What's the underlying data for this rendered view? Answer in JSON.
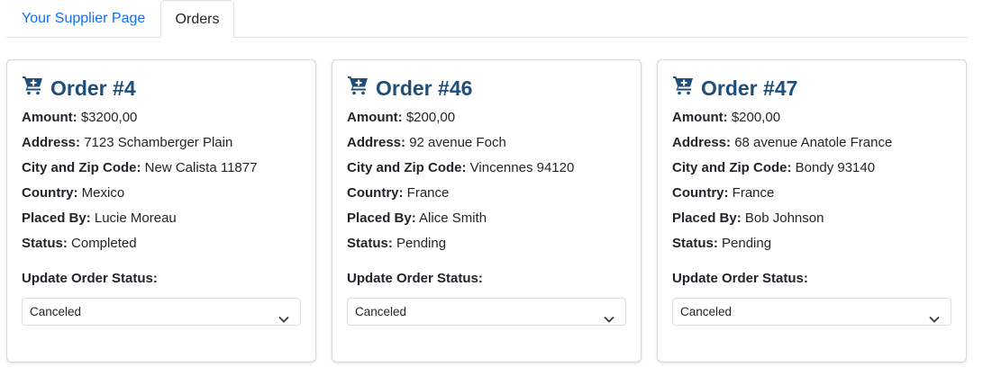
{
  "tabs": [
    {
      "label": "Your Supplier Page"
    },
    {
      "label": "Orders"
    }
  ],
  "labels": {
    "amount": "Amount:",
    "address": "Address:",
    "city_zip": "City and Zip Code:",
    "country": "Country:",
    "placed_by": "Placed By:",
    "status": "Status:",
    "update_status": "Update Order Status:"
  },
  "icons": {
    "order": "cart-plus-icon",
    "dropdown": "chevron-down-icon"
  },
  "colors": {
    "link": "#0d6efd",
    "title": "#1f4e79"
  },
  "orders": [
    {
      "title": "Order #4",
      "amount": "$3200,00",
      "address": "7123 Schamberger Plain",
      "city_zip": "New Calista 11877",
      "country": "Mexico",
      "placed_by": "Lucie Moreau",
      "status": "Completed",
      "select_value": "Canceled"
    },
    {
      "title": "Order #46",
      "amount": "$200,00",
      "address": "92 avenue Foch",
      "city_zip": "Vincennes 94120",
      "country": "France",
      "placed_by": "Alice Smith",
      "status": "Pending",
      "select_value": "Canceled"
    },
    {
      "title": "Order #47",
      "amount": "$200,00",
      "address": "68 avenue Anatole France",
      "city_zip": "Bondy 93140",
      "country": "France",
      "placed_by": "Bob Johnson",
      "status": "Pending",
      "select_value": "Canceled"
    }
  ]
}
